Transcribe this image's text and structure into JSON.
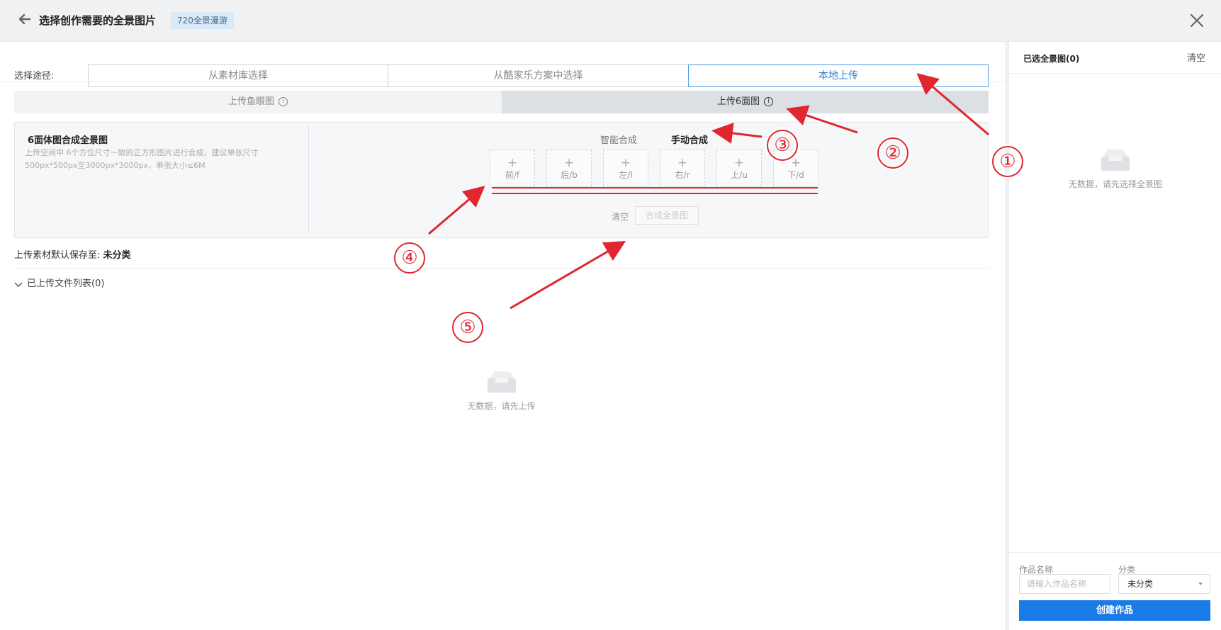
{
  "header": {
    "title": "选择创作需要的全景图片",
    "tag": "720全景漫游"
  },
  "route": {
    "label": "选择途径:",
    "options": [
      "从素材库选择",
      "从酷家乐方案中选择",
      "本地上传"
    ],
    "selected": "本地上传"
  },
  "upload_tabs": {
    "fisheye": "上传鱼眼图",
    "six_face": "上传6面图",
    "selected": "上传6面图"
  },
  "panel": {
    "heading": "6面体图合成全景图",
    "description": "上传空间中 6个方位尺寸一致的正方形图片进行合成，建议单张尺寸500px*500px至3000px*3000px，单张大小≤6M",
    "modes": {
      "smart": "智能合成",
      "manual": "手动合成",
      "selected": "手动合成"
    },
    "slots": [
      {
        "label": "前/f"
      },
      {
        "label": "后/b"
      },
      {
        "label": "左/l"
      },
      {
        "label": "右/r"
      },
      {
        "label": "上/u"
      },
      {
        "label": "下/d"
      }
    ],
    "plus_symbol": "+",
    "clear_label": "清空",
    "merge_label": "合成全景图"
  },
  "save_to": {
    "prefix": "上传素材默认保存至:",
    "category": "未分类"
  },
  "file_list": {
    "label": "已上传文件列表(0)"
  },
  "main_empty": {
    "text": "无数据，请先上传"
  },
  "sidebar": {
    "header": "已选全景图(0)",
    "clear_label": "清空",
    "empty_text": "无数据，请先选择全景图",
    "name_label": "作品名称",
    "name_placeholder": "请输入作品名称",
    "category_label": "分类",
    "category_value": "未分类",
    "create_label": "创建作品"
  },
  "annotations": [
    "①",
    "②",
    "③",
    "④",
    "⑤"
  ],
  "colors": {
    "accent": "#1a7ae6",
    "annotation_red": "#e0262e",
    "tab_active_text": "#2a7fd4"
  }
}
